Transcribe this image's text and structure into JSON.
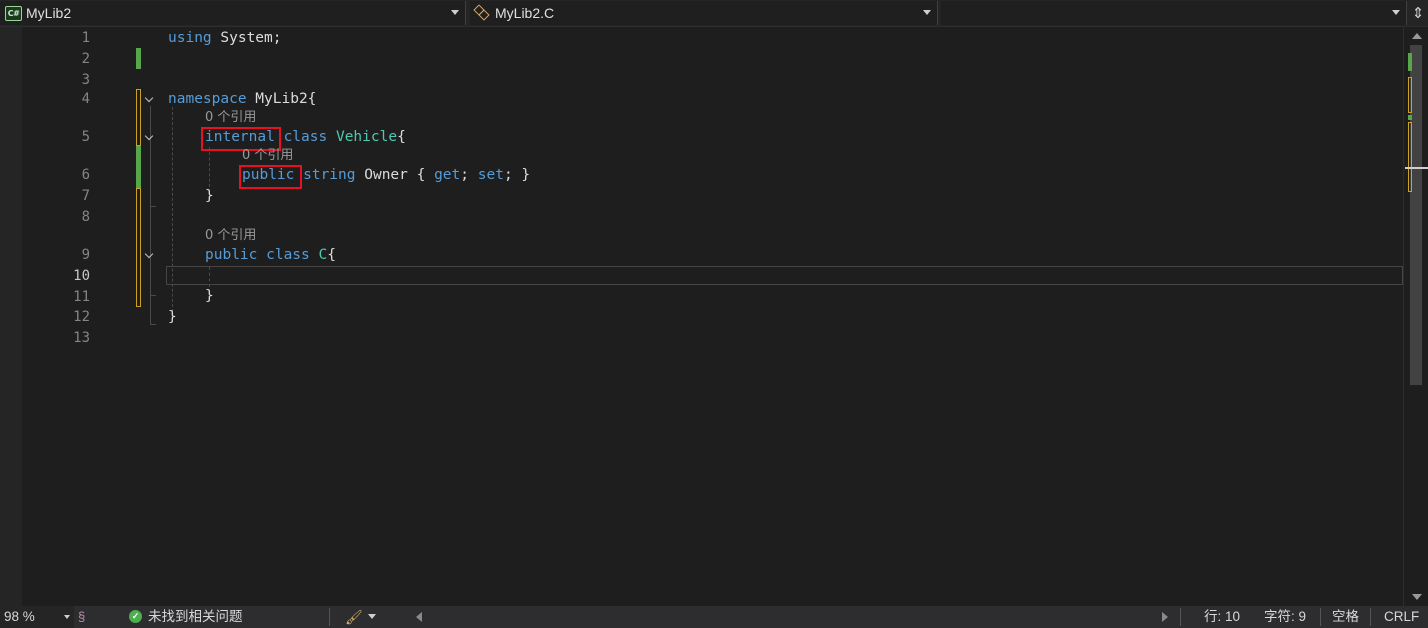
{
  "navbar": {
    "project": "MyLib2",
    "project_icon": "csharp-icon",
    "type": "MyLib2.C",
    "type_icon": "class-icon",
    "member": ""
  },
  "lines": [
    "1",
    "2",
    "3",
    "4",
    "5",
    "6",
    "7",
    "8",
    "9",
    "10",
    "11",
    "12",
    "13"
  ],
  "active_line": "10",
  "code": {
    "l1_kw": "using",
    "l1_rest": " System;",
    "l4_kw": "namespace",
    "l4_rest": " MyLib2{",
    "lens_vehicle": "0 个引用",
    "l5_kw1": "internal",
    "l5_kw2": " class",
    "l5_type": " Vehicle",
    "l5_brace": "{",
    "lens_owner": "0 个引用",
    "l6_kw1": "public",
    "l6_kw2": " string",
    "l6_name": " Owner { ",
    "l6_get": "get",
    "l6_semi1": "; ",
    "l6_set": "set",
    "l6_end": "; }",
    "l7": "}",
    "lens_c": "0 个引用",
    "l9_kw1": "public",
    "l9_kw2": " class",
    "l9_type": " C",
    "l9_brace": "{",
    "l11": "}",
    "l12": "}"
  },
  "status": {
    "zoom": "98 %",
    "issues": "未找到相关问题",
    "line": "行: 10",
    "char": "字符: 9",
    "spaces": "空格",
    "eol": "CRLF"
  },
  "colors": {
    "keyword": "#569cd6",
    "type": "#4ec9b0",
    "highlight_box": "#e81123",
    "change_saved": "#57a64a",
    "change_unsaved": "#c9a227"
  }
}
